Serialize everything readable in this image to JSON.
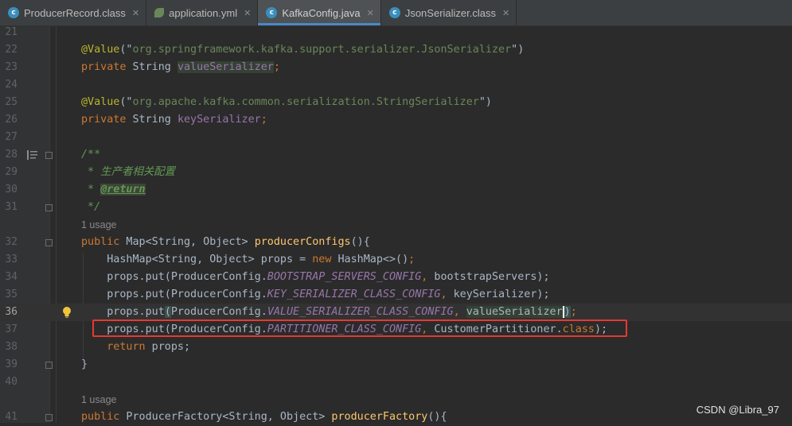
{
  "tabs": [
    {
      "label": "ProducerRecord.class",
      "icon": "class-file-icon",
      "active": false
    },
    {
      "label": "application.yml",
      "icon": "spring-yml-icon",
      "active": false
    },
    {
      "label": "KafkaConfig.java",
      "icon": "java-class-icon",
      "active": true
    },
    {
      "label": "JsonSerializer.class",
      "icon": "class-file-icon",
      "active": false
    }
  ],
  "tab_close": "✕",
  "lines": {
    "l21": "21",
    "l22": "22",
    "l23": "23",
    "l24": "24",
    "l25": "25",
    "l26": "26",
    "l27": "27",
    "l28": "28",
    "l29": "29",
    "l30": "30",
    "l31": "31",
    "l32": "32",
    "l33": "33",
    "l34": "34",
    "l35": "35",
    "l36": "36",
    "l37": "37",
    "l38": "38",
    "l39": "39",
    "l40": "40",
    "l41": "41"
  },
  "usage_hint": "1 usage",
  "code": {
    "ann_value": "@Value",
    "paren_open_q": "(\"",
    "str_json": "org.springframework.kafka.support.serializer.JsonSerializer",
    "paren_close_q": "\")",
    "private": "private",
    "string_type": " String ",
    "value_serializer": "valueSerializer",
    "semicolon": ";",
    "str_string": "org.apache.kafka.common.serialization.StringSerializer",
    "key_serializer": "keySerializer",
    "doc_open": "/**",
    "doc_line1": " * 生产者相关配置",
    "doc_star": " * ",
    "doc_return": "@return",
    "doc_close": " */",
    "public": "public",
    "map_sig": " Map<String, Object> ",
    "producer_configs": "producerConfigs",
    "sig_end": "(){",
    "hashmap_decl": "    HashMap<String, Object> props = ",
    "new": "new",
    "hashmap_init": " HashMap<>()",
    "props_put": "    props.put(ProducerConfig.",
    "props_put_nb": "    props.put",
    "paren_l": "(",
    "producer_config_dot": "ProducerConfig.",
    "bootstrap_const": "BOOTSTRAP_SERVERS_CONFIG",
    "comma": ", ",
    "bootstrap_servers": "bootstrapServers",
    "close_semi": ");",
    "key_ser_const": "KEY_SERIALIZER_CLASS_CONFIG",
    "val_ser_const": "VALUE_SERIALIZER_CLASS_CONFIG",
    "paren_r": ")",
    "partitioner_const": "PARTITIONER_CLASS_CONFIG",
    "customer_partitioner": "CustomerPartitioner.",
    "class_kw": "class",
    "return_kw": "    return",
    "props_ret": " props;",
    "close_brace": "}",
    "pf_sig": " ProducerFactory<String, Object> ",
    "producer_factory": "producerFactory",
    "pf_end": "(){"
  },
  "watermark": "CSDN @Libra_97",
  "colors": {
    "keyword": "#cc7832",
    "annotation": "#bbb529",
    "string": "#6a8759",
    "method": "#ffc66d",
    "field": "#9876aa",
    "comment": "#629755",
    "highlight_box": "#e53935"
  }
}
